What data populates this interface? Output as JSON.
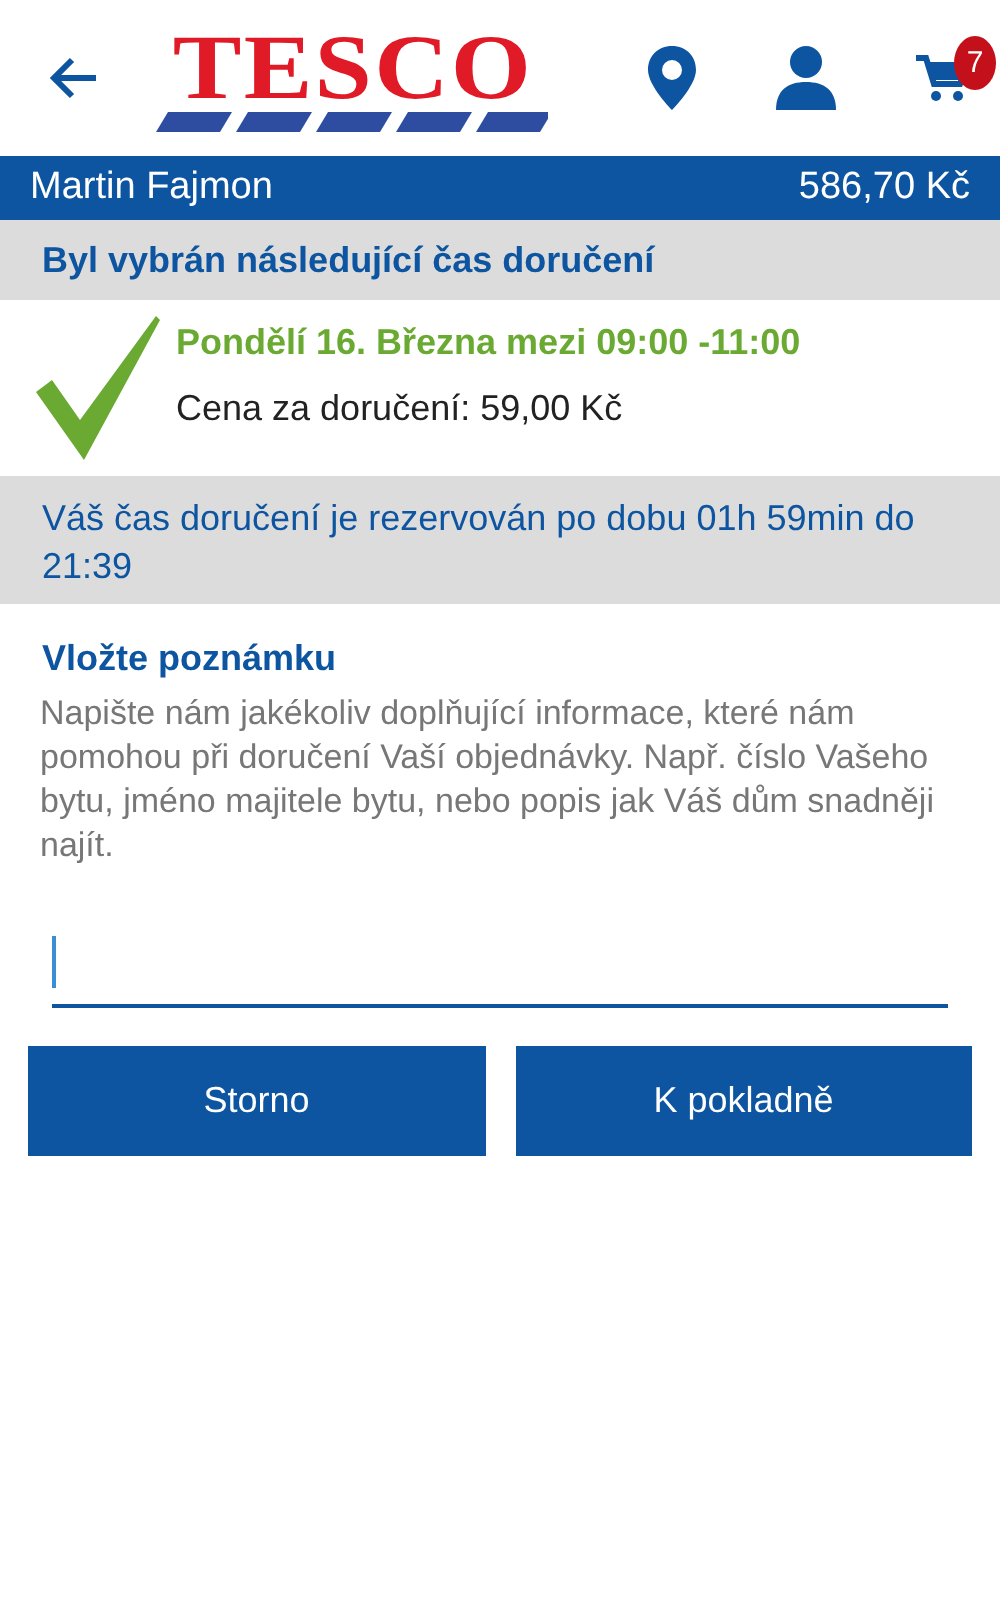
{
  "header": {
    "logo": "TESCO",
    "cart_count": "7"
  },
  "account_bar": {
    "name": "Martin Fajmon",
    "balance": "586,70 Kč"
  },
  "selected_heading": "Byl vybrán následující čas doručení",
  "delivery": {
    "slot": "Pondělí 16. Března mezi 09:00 -11:00",
    "price": "Cena za doručení: 59,00 Kč"
  },
  "reservation_notice": "Váš čas doručení je rezervován po dobu 01h 59min do 21:39",
  "note": {
    "title": "Vložte poznámku",
    "description": "Napište nám jakékoliv doplňující informace, které nám pomohou při doručení Vaší objednávky. Např. číslo Vašeho bytu, jméno majitele bytu, nebo popis jak Váš dům snadněji najít.",
    "focused": true
  },
  "buttons": [
    {
      "label": "Storno"
    },
    {
      "label": "K pokladně"
    }
  ]
}
